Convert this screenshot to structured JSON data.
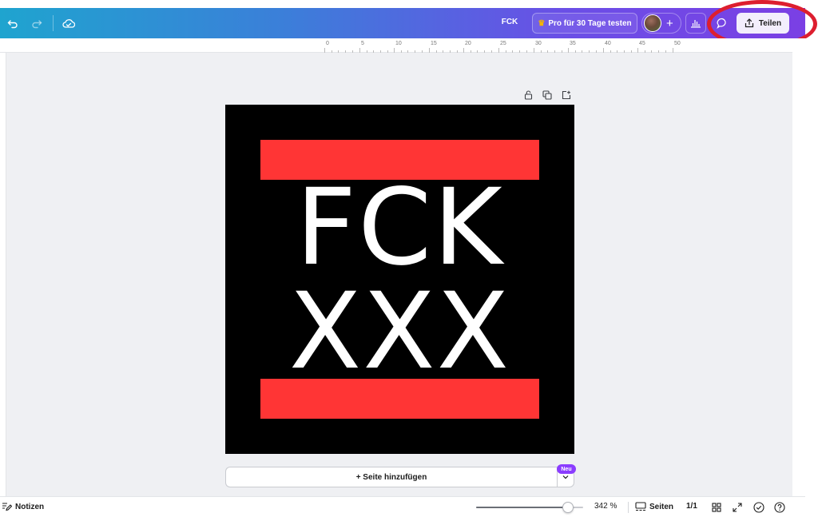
{
  "header": {
    "document_title": "FCK",
    "pro_trial_label": "Pro für 30 Tage testen",
    "share_label": "Teilen"
  },
  "ruler": {
    "marks": [
      "0",
      "5",
      "10",
      "15",
      "20",
      "25",
      "30",
      "35",
      "40",
      "45",
      "50"
    ]
  },
  "design": {
    "line1": "FCK",
    "line2": "XXX",
    "colors": {
      "background": "#000000",
      "bars": "#ff3535",
      "text": "#ffffff"
    }
  },
  "add_page": {
    "label": "+ Seite hinzufügen",
    "badge": "Neu"
  },
  "footer": {
    "notes_label": "Notizen",
    "zoom_label": "342 %",
    "zoom_fraction": 0.86,
    "pages_label": "Seiten",
    "page_count": "1/1"
  },
  "colors": {
    "brand_gradient_start": "#1fa4cf",
    "brand_gradient_end": "#7b3fe4",
    "accent_purple": "#8b3dff",
    "highlight_ring": "#dd1e2f"
  }
}
